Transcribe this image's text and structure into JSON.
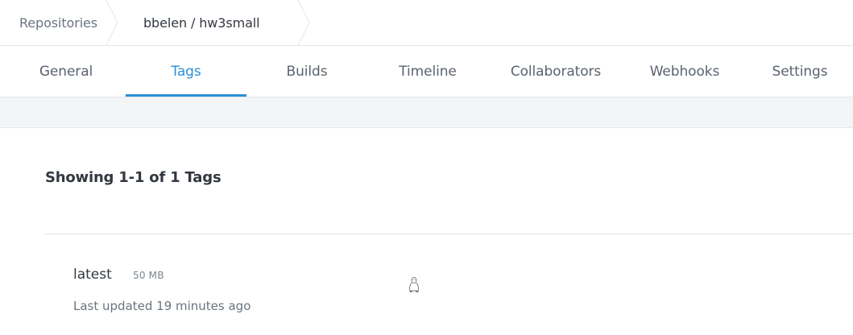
{
  "breadcrumb": {
    "items": [
      {
        "label": "Repositories"
      },
      {
        "label": "bbelen / hw3small"
      }
    ]
  },
  "tabs": [
    {
      "label": "General",
      "active": false
    },
    {
      "label": "Tags",
      "active": true
    },
    {
      "label": "Builds",
      "active": false
    },
    {
      "label": "Timeline",
      "active": false
    },
    {
      "label": "Collaborators",
      "active": false
    },
    {
      "label": "Webhooks",
      "active": false
    },
    {
      "label": "Settings",
      "active": false
    }
  ],
  "colors": {
    "accent": "#2a8fd6",
    "band": "#f4f5f7",
    "divider": "#e3e6e9"
  },
  "summary": {
    "text": "Showing 1-1 of 1 Tags"
  },
  "tags": [
    {
      "name": "latest",
      "size": "50 MB",
      "updated": "Last updated 19 minutes ago",
      "os_icon": "linux-icon"
    }
  ]
}
